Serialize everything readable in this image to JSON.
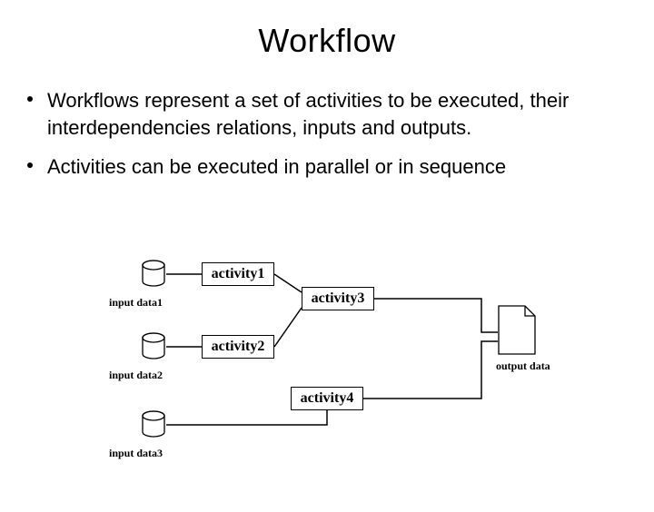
{
  "title": "Workflow",
  "bullets": [
    "Workflows represent a set of activities to be executed, their interdependencies relations, inputs and outputs.",
    "Activities can be executed in parallel or in sequence"
  ],
  "diagram": {
    "inputs": [
      {
        "label": "input data1"
      },
      {
        "label": "input data2"
      },
      {
        "label": "input data3"
      }
    ],
    "activities": [
      {
        "label": "activity1"
      },
      {
        "label": "activity2"
      },
      {
        "label": "activity3"
      },
      {
        "label": "activity4"
      }
    ],
    "output": {
      "label": "output data"
    }
  }
}
